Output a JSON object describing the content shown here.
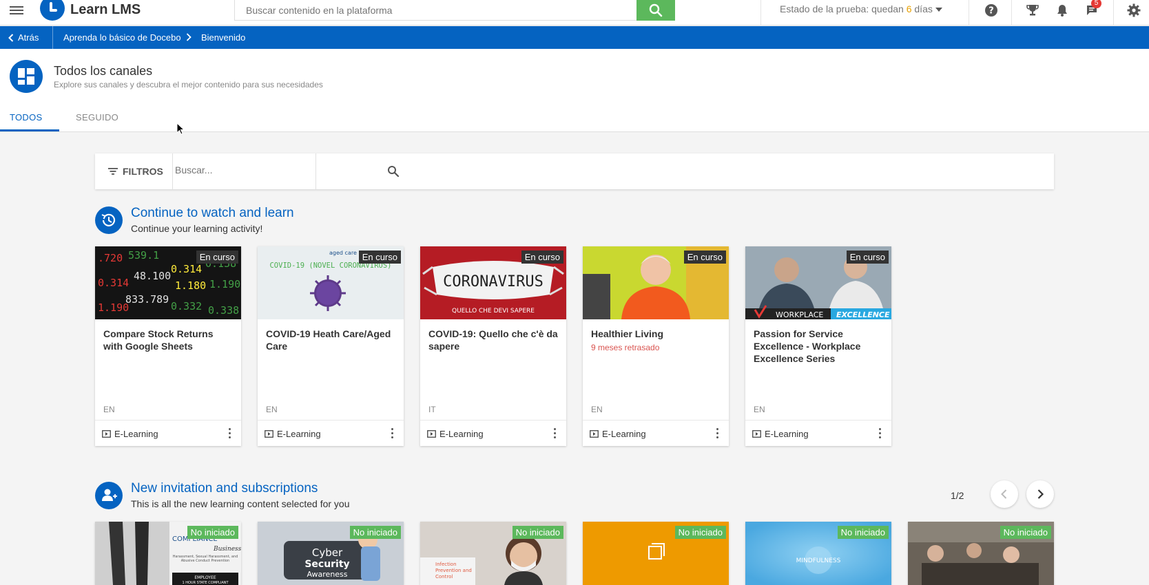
{
  "app": {
    "name": "Learn LMS"
  },
  "search": {
    "placeholder": "Buscar contenido en la plataforma"
  },
  "trial": {
    "prefix": "Estado de la prueba: quedan ",
    "days": "6",
    "suffix": " días"
  },
  "notifications": {
    "count": "5"
  },
  "breadcrumb": {
    "back": "Atrás",
    "items": [
      "Aprenda lo básico de Docebo",
      "Bienvenido"
    ]
  },
  "page": {
    "title": "Todos los canales",
    "subtitle": "Explore sus canales y descubra el mejor contenido para sus necesidades",
    "tabs": [
      "TODOS",
      "SEGUIDO"
    ]
  },
  "filters": {
    "label": "FILTROS",
    "placeholder": "Buscar..."
  },
  "sections": [
    {
      "title": "Continue to watch and learn",
      "subtitle": "Continue your learning activity!",
      "cards": [
        {
          "status": "En curso",
          "title": "Compare Stock Returns with Google Sheets",
          "late": "",
          "lang": "EN",
          "type": "E-Learning",
          "thumb_color": "#1a1a1a"
        },
        {
          "status": "En curso",
          "title": "COVID-19 Heath Care/Aged Care",
          "late": "",
          "lang": "EN",
          "type": "E-Learning",
          "thumb_color": "#e9eef0",
          "thumb_text": "COVID-19 (NOVEL CORONAVIRUS)",
          "thumb_brand": "aged care"
        },
        {
          "status": "En curso",
          "title": "COVID-19: Quello che c'è da sapere",
          "late": "",
          "lang": "IT",
          "type": "E-Learning",
          "thumb_color": "#b51c24",
          "thumb_text": "CORONAVIRUS",
          "thumb_sub": "QUELLO CHE DEVI SAPERE"
        },
        {
          "status": "En curso",
          "title": "Healthier Living",
          "late": "9 meses retrasado",
          "lang": "EN",
          "type": "E-Learning",
          "thumb_color": "#c9d830"
        },
        {
          "status": "En curso",
          "title": "Passion for Service Excellence - Workplace Excellence Series",
          "late": "",
          "lang": "EN",
          "type": "E-Learning",
          "thumb_color": "#8a9aa8",
          "thumb_text": "WORKPLACE",
          "thumb_text2": "EXCELLENCE"
        }
      ]
    },
    {
      "title": "New invitation and subscriptions",
      "subtitle": "This is all the new learning content selected for you",
      "pager": "1/2",
      "cards": [
        {
          "status": "No iniciado",
          "thumb_color": "#f2f2f2",
          "thumb_text": "COMPLIANCE",
          "thumb_text2": "Business",
          "thumb_sub": "Harassment, Sexual Harassment, and Abusive Conduct Prevention",
          "thumb_badge": "EMPLOYEE",
          "thumb_badge2": "1 HOUR STATE COMPLIANT"
        },
        {
          "status": "No iniciado",
          "thumb_color": "#c9cfd6",
          "thumb_text": "Cyber",
          "thumb_text2": "Security",
          "thumb_sub": "Awareness"
        },
        {
          "status": "No iniciado",
          "thumb_color": "#d8d2cc",
          "thumb_text": "Infection Prevention and Control"
        },
        {
          "status": "No iniciado",
          "thumb_color": "#ee9a00"
        },
        {
          "status": "No iniciado",
          "thumb_color": "#5db6e8",
          "thumb_text": "MINDFULNESS"
        },
        {
          "status": "No iniciado",
          "thumb_color": "#6a6258"
        }
      ]
    }
  ]
}
